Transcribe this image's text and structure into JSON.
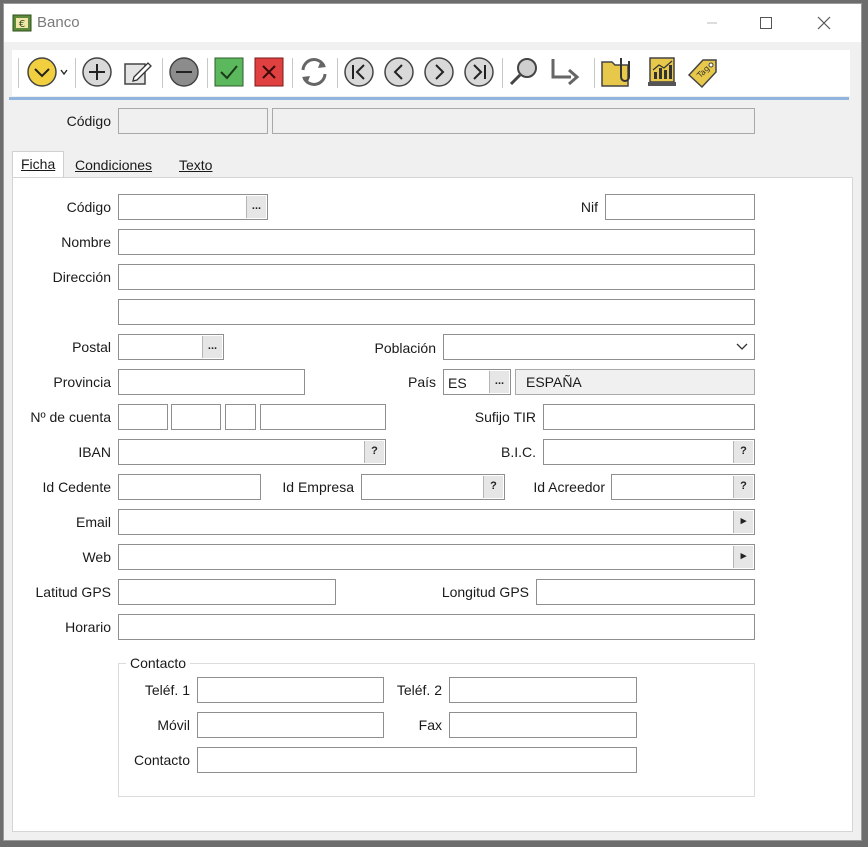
{
  "window": {
    "title": "Banco"
  },
  "toolbar": {
    "buttons": [
      "menu-dropdown",
      "add",
      "edit",
      "remove",
      "accept",
      "cancel",
      "refresh",
      "first",
      "previous",
      "next",
      "last",
      "search",
      "goto",
      "documents",
      "statistics",
      "tags"
    ]
  },
  "header": {
    "codigo_label": "Código"
  },
  "tabs": [
    {
      "label": "Ficha",
      "active": true
    },
    {
      "label": "Condiciones",
      "active": false
    },
    {
      "label": "Texto",
      "active": false
    }
  ],
  "form": {
    "codigo": {
      "label": "Código",
      "value": ""
    },
    "nif": {
      "label": "Nif",
      "value": ""
    },
    "nombre": {
      "label": "Nombre",
      "value": ""
    },
    "direccion": {
      "label": "Dirección",
      "value": ""
    },
    "postal": {
      "label": "Postal",
      "value": ""
    },
    "poblacion": {
      "label": "Población",
      "value": ""
    },
    "provincia": {
      "label": "Provincia",
      "value": ""
    },
    "pais": {
      "label": "País",
      "code": "ES",
      "name": "ESPAÑA"
    },
    "cuenta": {
      "label": "Nº de cuenta"
    },
    "sufijo": {
      "label": "Sufijo TIR"
    },
    "iban": {
      "label": "IBAN"
    },
    "bic": {
      "label": "B.I.C."
    },
    "id_cedente": {
      "label": "Id Cedente"
    },
    "id_empresa": {
      "label": "Id Empresa"
    },
    "id_acreedor": {
      "label": "Id Acreedor"
    },
    "email": {
      "label": "Email"
    },
    "web": {
      "label": "Web"
    },
    "latitud": {
      "label": "Latitud GPS"
    },
    "longitud": {
      "label": "Longitud GPS"
    },
    "horario": {
      "label": "Horario"
    }
  },
  "contacto_group": {
    "title": "Contacto",
    "telef1": "Teléf. 1",
    "telef2": "Teléf. 2",
    "movil": "Móvil",
    "fax": "Fax",
    "contacto": "Contacto"
  },
  "buttons": {
    "ellipsis": "...",
    "help": "?",
    "arrow": "▸"
  },
  "colors": {
    "accent_line": "#91b5df",
    "accept": "#5cb85c",
    "cancel": "#e04040",
    "dropdown_yellow": "#f2cf3f"
  }
}
